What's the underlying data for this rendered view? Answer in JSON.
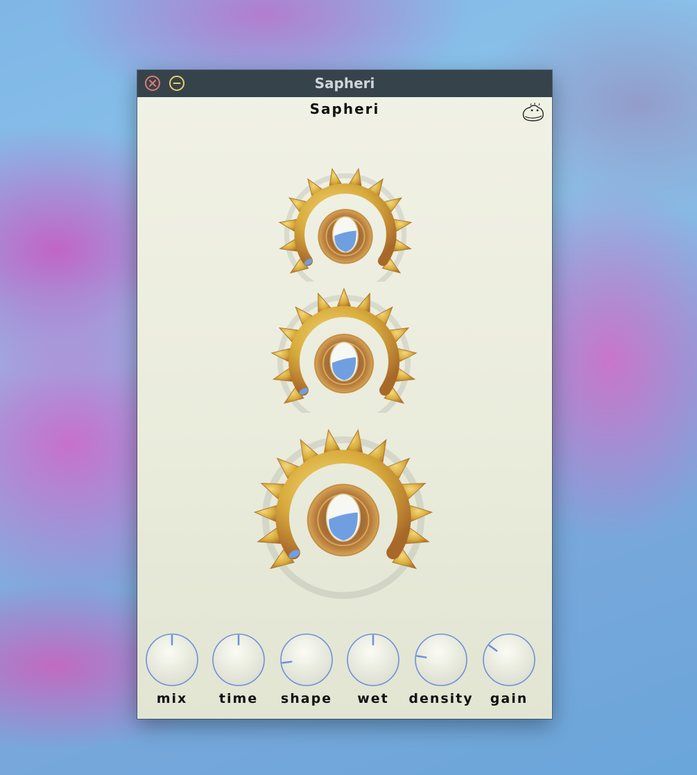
{
  "window": {
    "title": "Sapheri",
    "buttons": {
      "close_icon": "close-icon",
      "minimize_icon": "minimize-icon"
    }
  },
  "plugin": {
    "title": "Sapheri",
    "logo_icon": "frog-logo-icon"
  },
  "colors": {
    "titlebar": "#37434a",
    "panel": "#eeefe2",
    "gold": "#d8ac3c",
    "jewel_blue": "#6f9fe0",
    "knob_outline": "#6f8fd8"
  },
  "big_knobs": [
    {
      "name": "top-gear-knob"
    },
    {
      "name": "middle-gear-knob"
    },
    {
      "name": "bottom-gear-knob"
    }
  ],
  "knobs": [
    {
      "label": "mix",
      "value": 0.5
    },
    {
      "label": "time",
      "value": 0.5
    },
    {
      "label": "shape",
      "value": 0.14
    },
    {
      "label": "wet",
      "value": 0.5
    },
    {
      "label": "density",
      "value": 0.2
    },
    {
      "label": "gain",
      "value": 0.3
    }
  ]
}
